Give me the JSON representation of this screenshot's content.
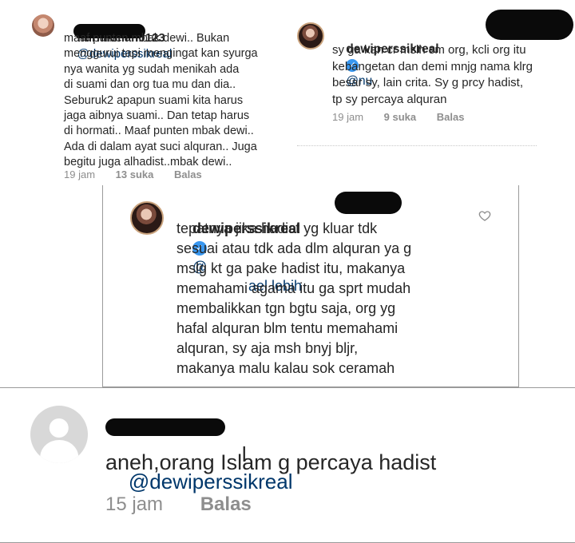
{
  "comment1": {
    "username": "nurhikmah0123",
    "mention": "@dewiperssikreal",
    "body": "maaf punten mbak dewi.. Bukan\nmenggurui tapi mengingat kan syurga\nnya wanita yg sudah menikah ada\ndi suami dan org tua mu dan dia..\nSeburuk2 apapun suami kita harus\njaga aibnya suami.. Dan tetap harus\ndi hormati.. Maaf punten mbak dewi..\nAda di dalam ayat suci alquran.. Juga\nbegitu juga alhadist..mbak dewi..",
    "time": "19 jam",
    "likes": "13 suka",
    "reply": "Balas"
  },
  "comment2": {
    "username": "dewiperssikreal",
    "mention": "@nu",
    "body": "sy ga kan cr mslh sm org, kcli org itu\nkebangetan dan demi mnjg nama klrg\nbesar sy, lain crita. Sy g prcy hadist,\ntp sy percaya alquran",
    "time": "19 jam",
    "likes": "9 suka",
    "reply": "Balas"
  },
  "comment3": {
    "username": "dewiperssikreal",
    "mention": "@",
    "mention_tail": "ael lebih",
    "body": "tepatnya jika hadist yg kluar tdk\nsesuai atau tdk ada dlm alquran ya g\nmslg kt ga pake hadist itu, makanya\nmemahami agama itu ga sprt mudah\nmembalikkan tgn bgtu saja, org yg\nhafal alquran blm tentu memahami\nalquran, sy aja msh bnyj bljr,\nmakanya malu kalau sok ceramah"
  },
  "comment4": {
    "username_tail": "l",
    "mention": "@dewiperssikreal",
    "body": "aneh,orang Islam g percaya hadist",
    "time": "15 jam",
    "reply": "Balas"
  },
  "colors": {
    "text": "#262626",
    "meta": "#8e8e8e",
    "mention": "#00376b",
    "verified": "#3897f0",
    "redaction": "#0a0a0a"
  }
}
